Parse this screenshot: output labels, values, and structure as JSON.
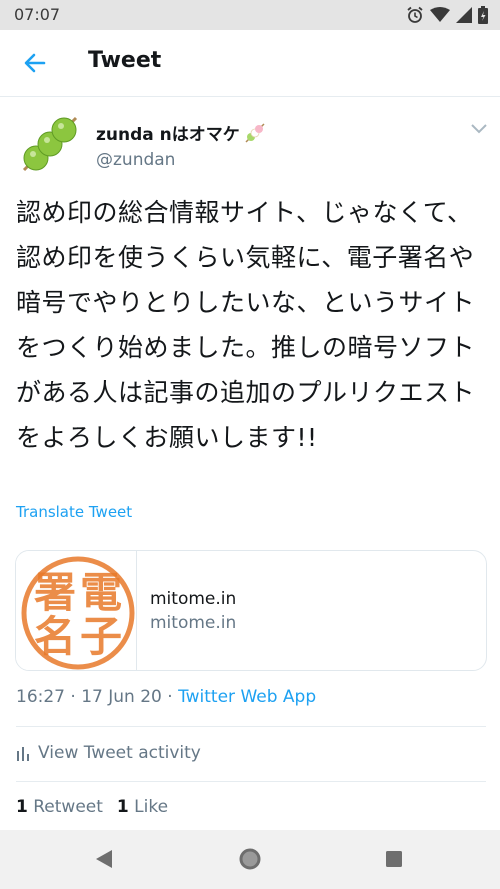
{
  "status_bar": {
    "time": "07:07",
    "icons": [
      "alarm-icon",
      "wifi-icon",
      "signal-icon",
      "battery-icon"
    ]
  },
  "app_bar": {
    "back_icon": "arrow-left-icon",
    "title": "Tweet"
  },
  "tweet": {
    "display_name": "zunda nはオマケ",
    "handle": "@zundan",
    "text": "認め印の総合情報サイト、じゃなくて、認め印を使うくらい気軽に、電子署名や暗号でやりとりしたいな、というサイトをつくり始めました。推しの暗号ソフトがある人は記事の追加のプルリクエストをよろしくお願いします!!",
    "translate_label": "Translate Tweet",
    "link_card": {
      "title": "mitome.in",
      "domain": "mitome.in",
      "stamp_text": "電子署名"
    },
    "meta": {
      "time_date": "16:27 · 17 Jun 20 · ",
      "source": "Twitter Web App"
    },
    "activity_label": "View Tweet activity",
    "stats": {
      "retweet_count": "1",
      "retweet_label": "Retweet",
      "like_count": "1",
      "like_label": "Like"
    }
  },
  "colors": {
    "accent": "#1da1f2",
    "secondary_text": "#657786",
    "stamp": "#e8792a",
    "avatar_green": "#8cc63f"
  },
  "nav_bar": {
    "buttons": [
      "back-triangle-icon",
      "home-circle-icon",
      "recents-square-icon"
    ]
  }
}
